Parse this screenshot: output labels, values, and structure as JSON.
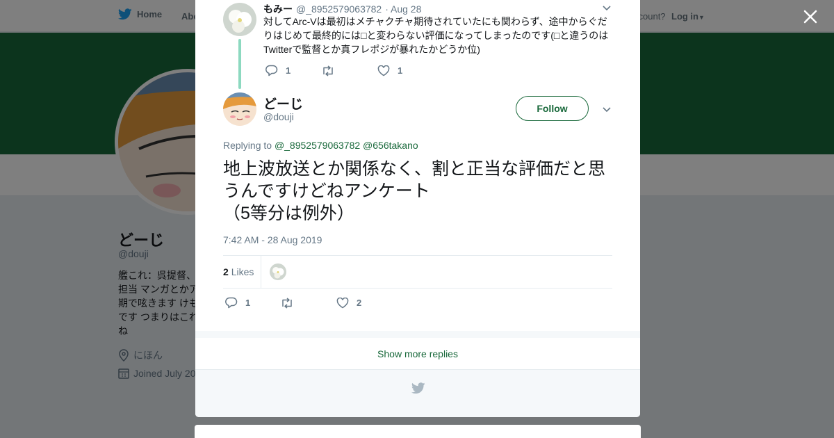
{
  "topnav": {
    "home_label": "Home",
    "about_label": "Abo",
    "account_text": "ccount?",
    "login_label": "Log in"
  },
  "profile": {
    "name": "どーじ",
    "handle": "@douji",
    "bio": "艦これ：呉提督、担当 マンガとかア期で呟きます けもです つまりはこれね",
    "location": "にほん",
    "joined": "Joined July 20"
  },
  "reply": {
    "name": "もみー",
    "handle": "@_8952579063782",
    "date": "· Aug 28",
    "text": "対してArc-Vは最初はメチャクチャ期待されていたにも関わらず、途中からぐだりはじめて最終的には□と変わらない評価になってしまったのです(□と違うのはTwitterで監督とか真フレポジが暴れたかどうか位)",
    "replies": "1",
    "retweets": "",
    "likes": "1"
  },
  "tweet": {
    "name": "どーじ",
    "handle": "@douji",
    "follow_label": "Follow",
    "replying_prefix": "Replying to",
    "replying_to_1": "@_8952579063782",
    "replying_to_2": "@656takano",
    "text": "地上波放送とか関係なく、割と正当な評価だと思うんですけどねアンケート\n（5等分は例外）",
    "timestamp": "7:42 AM - 28 Aug 2019",
    "likes_count": "2",
    "likes_label": "Likes",
    "replies": "1",
    "retweets": "",
    "likes": "2"
  },
  "show_more_label": "Show more replies",
  "colors": {
    "accent": "#18683a",
    "banner": "#18683a",
    "thread_line": "#8dd9c0",
    "text_muted": "#657786"
  }
}
